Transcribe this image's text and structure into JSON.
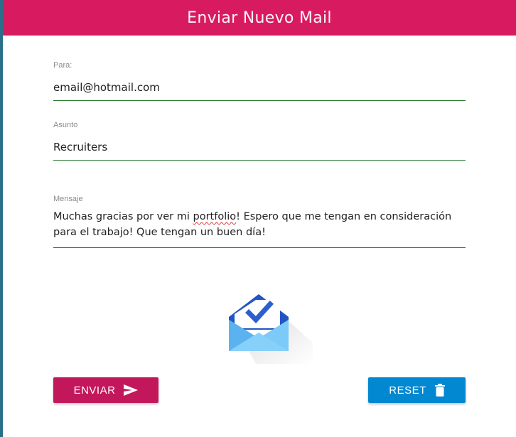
{
  "header": {
    "title": "Enviar Nuevo Mail"
  },
  "form": {
    "to": {
      "label": "Para:",
      "value": "email@hotmail.com"
    },
    "subject": {
      "label": "Asunto",
      "value": "Recruiters"
    },
    "message": {
      "label": "Mensaje",
      "value_part1": "Muchas gracias por ver mi ",
      "value_misspelled": "portfolio",
      "value_part2": "! Espero que me tengan en consideración para el trabajo! Que tengan un buen día!"
    }
  },
  "illustration": {
    "icon": "inbox-envelope-check-icon"
  },
  "buttons": {
    "send_label": "ENVIAR",
    "send_icon": "send-icon",
    "reset_label": "RESET",
    "reset_icon": "trash-icon"
  },
  "colors": {
    "header": "#d81b60",
    "send_button": "#c2185b",
    "reset_button": "#0288d1",
    "field_underline": "#2e7d32"
  }
}
